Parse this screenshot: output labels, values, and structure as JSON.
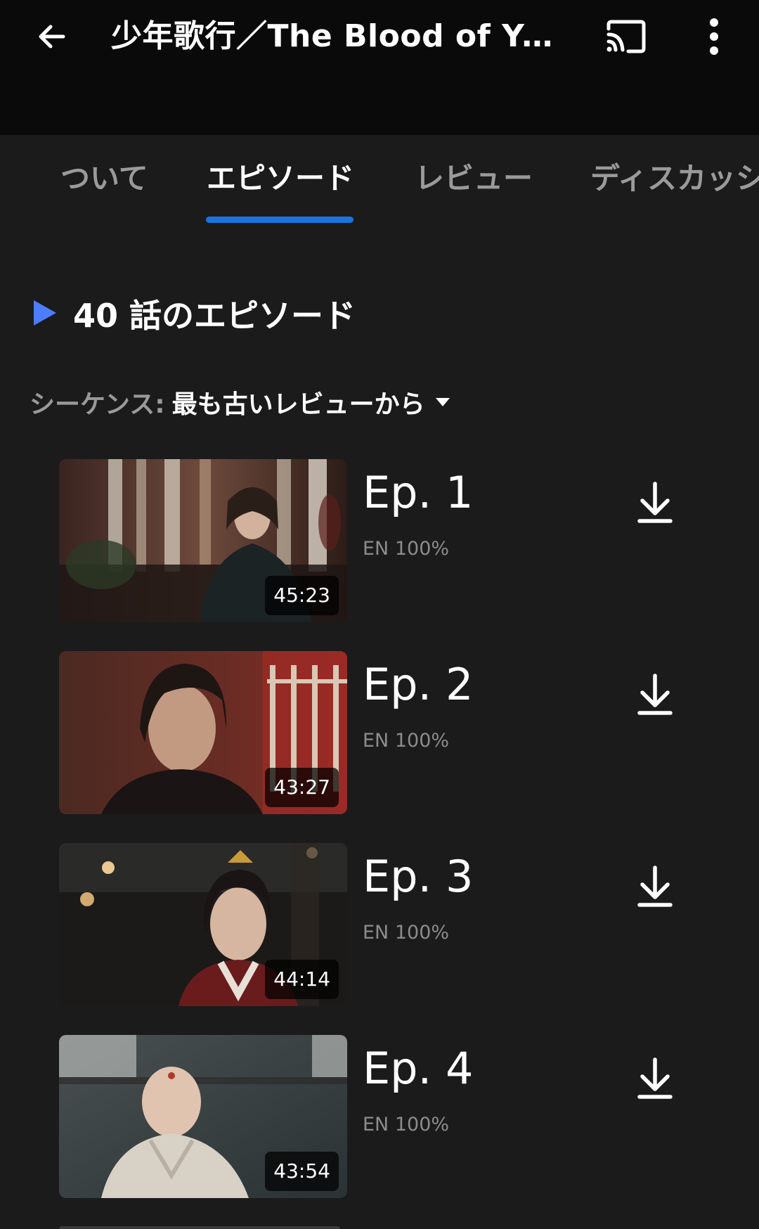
{
  "header": {
    "title": "少年歌行／The Blood of Yo...",
    "back_icon": "arrow-left-icon",
    "cast_icon": "cast-icon",
    "more_icon": "more-vertical-icon"
  },
  "tabs": [
    {
      "label": "ついて",
      "active": false
    },
    {
      "label": "エピソード",
      "active": true
    },
    {
      "label": "レビュー",
      "active": false
    },
    {
      "label": "ディスカッション",
      "active": false
    }
  ],
  "section": {
    "title": "40 話のエピソード",
    "accent": "#4c7dff"
  },
  "sort": {
    "label": "シーケンス:",
    "value": "最も古いレビューから"
  },
  "episodes": [
    {
      "title": "Ep. 1",
      "subtitle": "EN 100%",
      "duration": "45:23"
    },
    {
      "title": "Ep. 2",
      "subtitle": "EN 100%",
      "duration": "43:27"
    },
    {
      "title": "Ep. 3",
      "subtitle": "EN 100%",
      "duration": "44:14"
    },
    {
      "title": "Ep. 4",
      "subtitle": "EN 100%",
      "duration": "43:54"
    }
  ],
  "colors": {
    "background": "#1b1b1b",
    "topbar": "#0a0a0a",
    "tab_indicator": "#1b73e0",
    "muted_text": "#9a9a9a"
  }
}
